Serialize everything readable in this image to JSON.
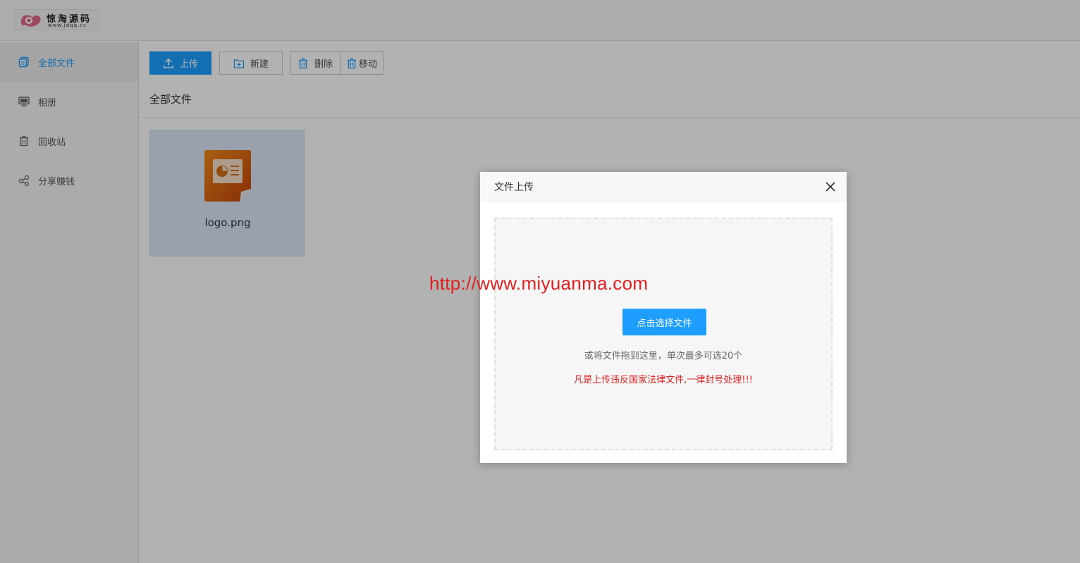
{
  "header": {
    "logo_title": "惊淘源码",
    "logo_url": "www.jdqq.cc"
  },
  "sidebar": {
    "items": [
      {
        "label": "全部文件",
        "icon": "files-icon",
        "active": true
      },
      {
        "label": "相册",
        "icon": "monitor-icon",
        "active": false
      },
      {
        "label": "回收站",
        "icon": "trash-icon",
        "active": false
      },
      {
        "label": "分享赚钱",
        "icon": "share-icon",
        "active": false
      }
    ]
  },
  "toolbar": {
    "upload_label": "上传",
    "new_label": "新建",
    "delete_label": "删除",
    "move_label": "移动"
  },
  "breadcrumb": {
    "title": "全部文件"
  },
  "files": [
    {
      "name": "logo.png",
      "icon": "presentation-file-icon"
    }
  ],
  "watermark": "http://www.miyuanma.com",
  "modal": {
    "title": "文件上传",
    "pick_button": "点击选择文件",
    "hint": "或将文件拖到这里，单次最多可选20个",
    "warning": "凡是上传违反国家法律文件,一律封号处理!!!"
  },
  "colors": {
    "accent": "#1E9FFF",
    "warning": "#e02020",
    "file_card_bg": "#dbe7f7"
  }
}
